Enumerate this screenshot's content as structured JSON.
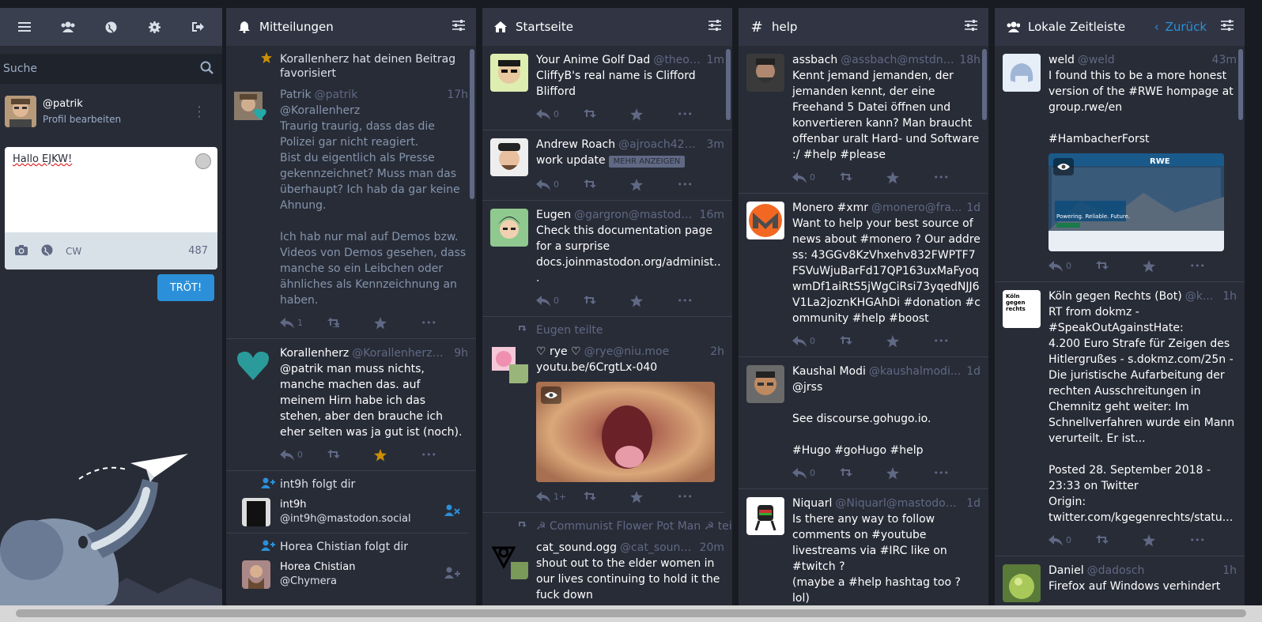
{
  "drawer": {
    "search_placeholder": "Suche",
    "profile_handle": "@patrik",
    "profile_edit": "Profil bearbeiten",
    "compose_text": "Hallo EJKW!",
    "cw_label": "CW",
    "char_count": "487",
    "toot_button": "TRÖT!"
  },
  "notifications": {
    "title": "Mitteilungen",
    "items": [
      {
        "notif": "Korallenherz hat deinen Beitrag favorisiert",
        "display_name": "Patrik",
        "acct": "@patrik",
        "time": "17h",
        "content": "@Korallenherz\nTraurig traurig, dass das die Polizei gar nicht reagiert.\nBist du eigentlich als Presse gekennzeichnet? Muss man das überhaupt? Ich hab da gar keine Ahnung.\n\nIch hab nur mal auf Demos bzw. Videos von Demos gesehen, dass manche so ein Leibchen oder ähnliches als Kennzeichnung an haben.",
        "replies": "1"
      },
      {
        "display_name": "Korallenherz",
        "acct": "@Korallenherz@...",
        "time": "9h",
        "content": "@patrik man muss nichts, manche machen das. auf meinem Hirn habe ich das stehen, aber den brauche ich eher selten was ja gut ist (noch).",
        "replies": "0"
      }
    ],
    "follows": [
      {
        "line": "int9h folgt dir",
        "name": "int9h",
        "acct": "@int9h@mastodon.social"
      },
      {
        "line": "Horea Chistian folgt dir",
        "name": "Horea Chistian",
        "acct": "@Chymera"
      }
    ]
  },
  "home": {
    "title": "Startseite",
    "items": [
      {
        "display_name": "Your Anime Golf Dad",
        "acct": "@theou...",
        "time": "1m",
        "content": "CliffyB's real name is Clifford Blifford",
        "replies": "0"
      },
      {
        "display_name": "Andrew Roach",
        "acct": "@ajroach42@r...",
        "time": "3m",
        "content": "work update",
        "more": "MEHR ANZEIGEN",
        "replies": "0"
      },
      {
        "display_name": "Eugen",
        "acct": "@gargron@mastodon...",
        "time": "16m",
        "content": "Check this documentation page for a surprise docs.joinmastodon.org/administ...",
        "replies": "0"
      },
      {
        "boost": "Eugen teilte",
        "display_name": "♡ rye ♡",
        "acct": "@rye@niu.moe",
        "time": "2h",
        "content": "youtu.be/6CrgtLx-040",
        "replies": "1+"
      },
      {
        "boost": "☭ Communist Flower Pot Man ☭ teilte",
        "display_name": "cat_sound.ogg",
        "acct": "@cat_sound...",
        "time": "20m",
        "content": "shout out to the elder women in our lives continuing to hold it the fuck down"
      }
    ]
  },
  "help": {
    "title": "help",
    "items": [
      {
        "display_name": "assbach",
        "acct": "@assbach@mstdn.io",
        "time": "18h",
        "content": "Kennt jemand jemanden, der jemanden kennt, der eine Freehand 5 Datei öffnen und konvertieren kann? Man braucht offenbar uralt Hard- und Software :/ #help #please",
        "replies": "0"
      },
      {
        "display_name": "Monero #xmr",
        "acct": "@monero@fra...",
        "time": "1d",
        "content": "Want to help your best source of news about #monero ? Our address: 43GGv8KzVhxehv832FWPTF7FSVuWjuBarFd17QP163uxMaFyoqwmDf1aiRtS5jWgCiRsi73yqedNJJ6V1La2joznKHGAhDi #donation #community #help #boost",
        "replies": "0"
      },
      {
        "display_name": "Kaushal Modi",
        "acct": "@kaushalmodi...",
        "time": "1d",
        "content": "@jrss\n\nSee discourse.gohugo.io.\n\n#Hugo #goHugo #help",
        "replies": "0"
      },
      {
        "display_name": "Niquarl",
        "acct": "@Niquarl@mastodon....",
        "time": "1d",
        "content": "Is there any way to follow comments on #youtube livestreams via #IRC like on #twitch ?\n(maybe a #help hashtag too ? lol)"
      }
    ]
  },
  "local": {
    "title": "Lokale Zeitleiste",
    "back": "Zurück",
    "items": [
      {
        "display_name": "weld",
        "acct": "@weld",
        "time": "43m",
        "content": "I found this to be a more honest version of the #RWE hompage at group.rwe/en\n\n#HambacherForst",
        "replies": "0",
        "media_text": "Powering. Reliable. Future.",
        "media_logo": "RWE"
      },
      {
        "display_name": "Köln gegen Rechts (Bot)",
        "acct": "@k...",
        "time": "1h",
        "content": "RT from dokmz - #SpeakOutAgainstHate:\n4.200 Euro Strafe für Zeigen des Hitlergrußes - s.dokmz.com/25n - Die juristische Aufarbeitung der rechten Ausschreitungen in Chemnitz geht weiter: Im Schnellverfahren wurde ein Mann verurteilt. Er ist...\n\nPosted 28. September 2018 - 23:33 on Twitter\nOrigin: twitter.com/kgegenrechts/statu...",
        "replies": "0",
        "avatar_text": "Köln gegen rechts"
      },
      {
        "display_name": "Daniel",
        "acct": "@dadosch",
        "time": "1h",
        "content": "Firefox auf Windows verhindert"
      }
    ]
  }
}
